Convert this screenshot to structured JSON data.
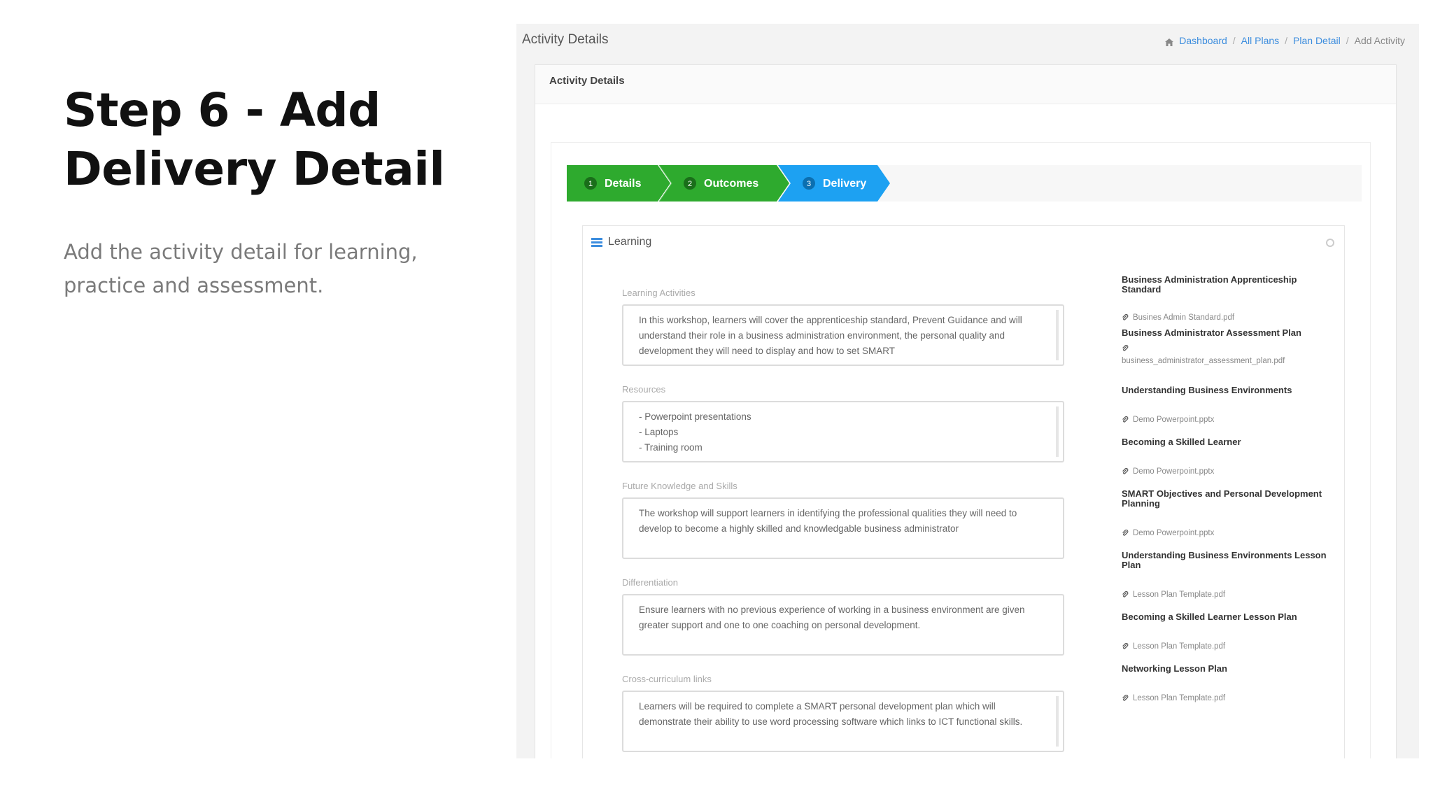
{
  "slide": {
    "title": "Step 6 - Add Delivery Detail",
    "description": "Add the activity detail for learning, practice and assessment."
  },
  "app": {
    "page_title": "Activity Details",
    "breadcrumb": {
      "items": [
        "Dashboard",
        "All Plans",
        "Plan Detail"
      ],
      "current": "Add Activity",
      "separator": "/"
    },
    "card_title": "Activity Details",
    "wizard": {
      "steps": [
        {
          "number": "1",
          "label": "Details",
          "state": "complete"
        },
        {
          "number": "2",
          "label": "Outcomes",
          "state": "complete"
        },
        {
          "number": "3",
          "label": "Delivery",
          "state": "active"
        }
      ],
      "colors": {
        "complete": "#2eaa2e",
        "active": "#1da1f2"
      }
    },
    "learning": {
      "heading": "Learning",
      "fields": [
        {
          "label": "Learning Activities",
          "value": "In this workshop, learners will cover the apprenticeship standard, Prevent Guidance and will understand their role in a business administration environment, the personal quality and development they will need to display and how to set SMART"
        },
        {
          "label": "Resources",
          "items": [
            "- Powerpoint presentations",
            "- Laptops",
            "- Training room"
          ]
        },
        {
          "label": "Future Knowledge and Skills",
          "value": "The workshop will support learners in identifying the professional qualities they will need to develop to become a highly skilled and knowledgable business administrator"
        },
        {
          "label": "Differentiation",
          "value": "Ensure learners with no previous experience of working in a business environment are given greater support and one to one coaching on personal development."
        },
        {
          "label": "Cross-curriculum links",
          "value": "Learners will be required to complete a SMART personal development plan which will demonstrate their ability to use word processing software which links to ICT functional skills."
        }
      ],
      "documents": [
        {
          "title": "Business Administration Apprenticeship Standard",
          "file": "Busines Admin Standard.pdf"
        },
        {
          "title": "Business Administrator Assessment Plan",
          "file": "business_administrator_assessment_plan.pdf"
        },
        {
          "title": "Understanding Business Environments",
          "file": "Demo Powerpoint.pptx"
        },
        {
          "title": "Becoming a Skilled Learner",
          "file": "Demo Powerpoint.pptx"
        },
        {
          "title": "SMART Objectives and Personal Development Planning",
          "file": "Demo Powerpoint.pptx"
        },
        {
          "title": "Understanding Business Environments Lesson Plan",
          "file": "Lesson Plan Template.pdf"
        },
        {
          "title": "Becoming a Skilled Learner Lesson Plan",
          "file": "Lesson Plan Template.pdf"
        },
        {
          "title": "Networking Lesson Plan",
          "file": "Lesson Plan Template.pdf"
        }
      ]
    }
  }
}
